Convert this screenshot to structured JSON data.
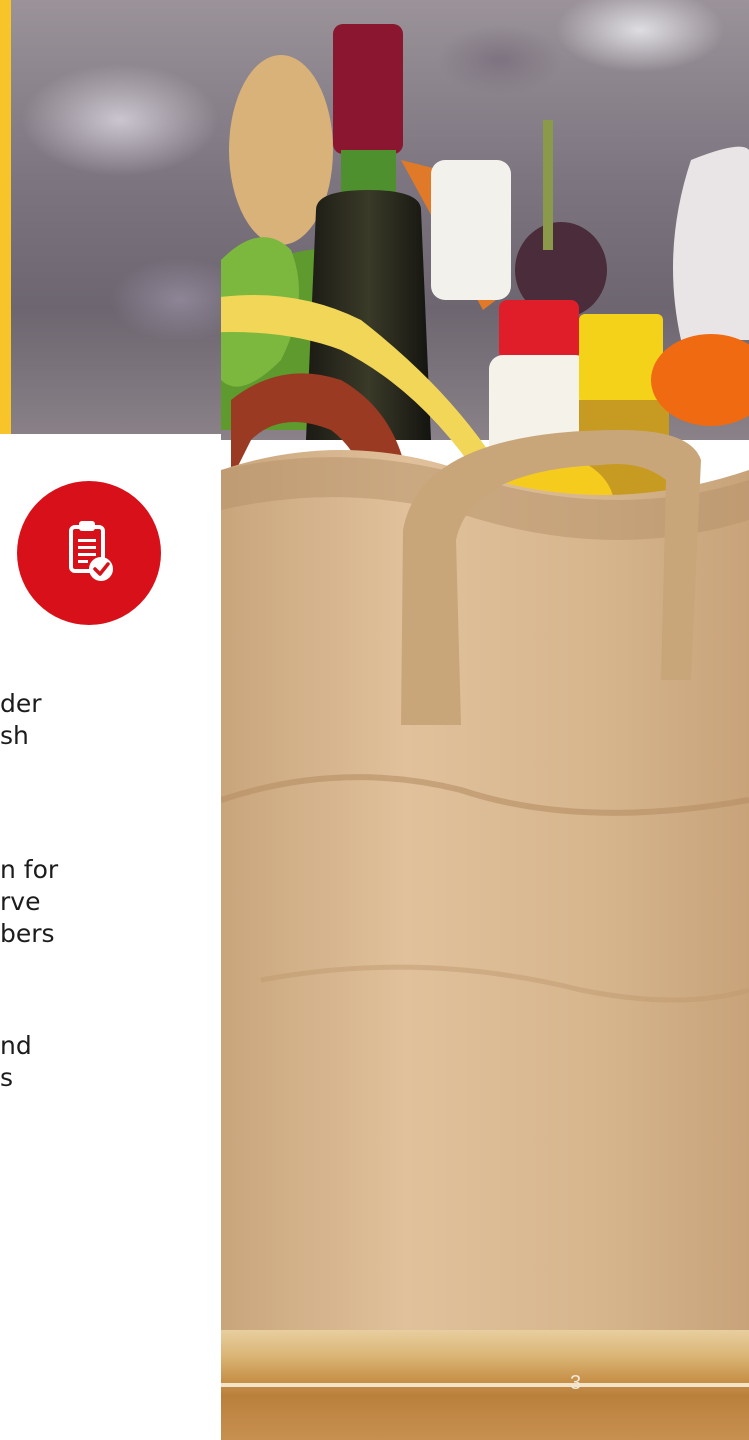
{
  "icon": {
    "name": "clipboard-check-icon",
    "color": "#d8101a"
  },
  "text_lines": [
    "der",
    "sh",
    "n for",
    "rve",
    "bers",
    "nd",
    "s"
  ],
  "page_number": "3"
}
